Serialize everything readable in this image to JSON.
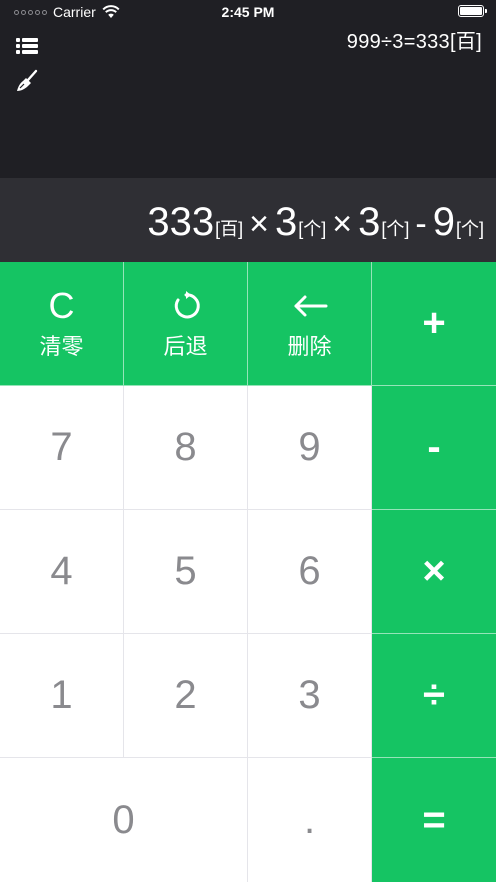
{
  "status_bar": {
    "carrier": "Carrier",
    "time": "2:45 PM"
  },
  "toolbar": {
    "list_icon": "list-icon",
    "clear_history_icon": "broom-icon"
  },
  "history": {
    "last": "999÷3=333[百]"
  },
  "expression": {
    "t1_num": "333",
    "t1_unit": "[百]",
    "op1": "×",
    "t2_num": "3",
    "t2_unit": "[个]",
    "op2": "×",
    "t3_num": "3",
    "t3_unit": "[个]",
    "op3": "-",
    "t4_num": "9",
    "t4_unit": "[个]"
  },
  "keys": {
    "clear": {
      "symbol": "C",
      "label": "清零"
    },
    "back": {
      "icon": "undo-icon",
      "label": "后退"
    },
    "delete": {
      "icon": "left-arrow-icon",
      "label": "删除"
    },
    "plus": "+",
    "minus": "-",
    "multiply": "×",
    "divide": "÷",
    "equals": "=",
    "seven": "7",
    "eight": "8",
    "nine": "9",
    "four": "4",
    "five": "5",
    "six": "6",
    "one": "1",
    "two": "2",
    "three": "3",
    "zero": "0",
    "dot": "."
  },
  "colors": {
    "accent": "#15c463",
    "top_bg": "#1f1f24",
    "display_bg": "#2f2f34",
    "digit": "#8a8a8e"
  }
}
